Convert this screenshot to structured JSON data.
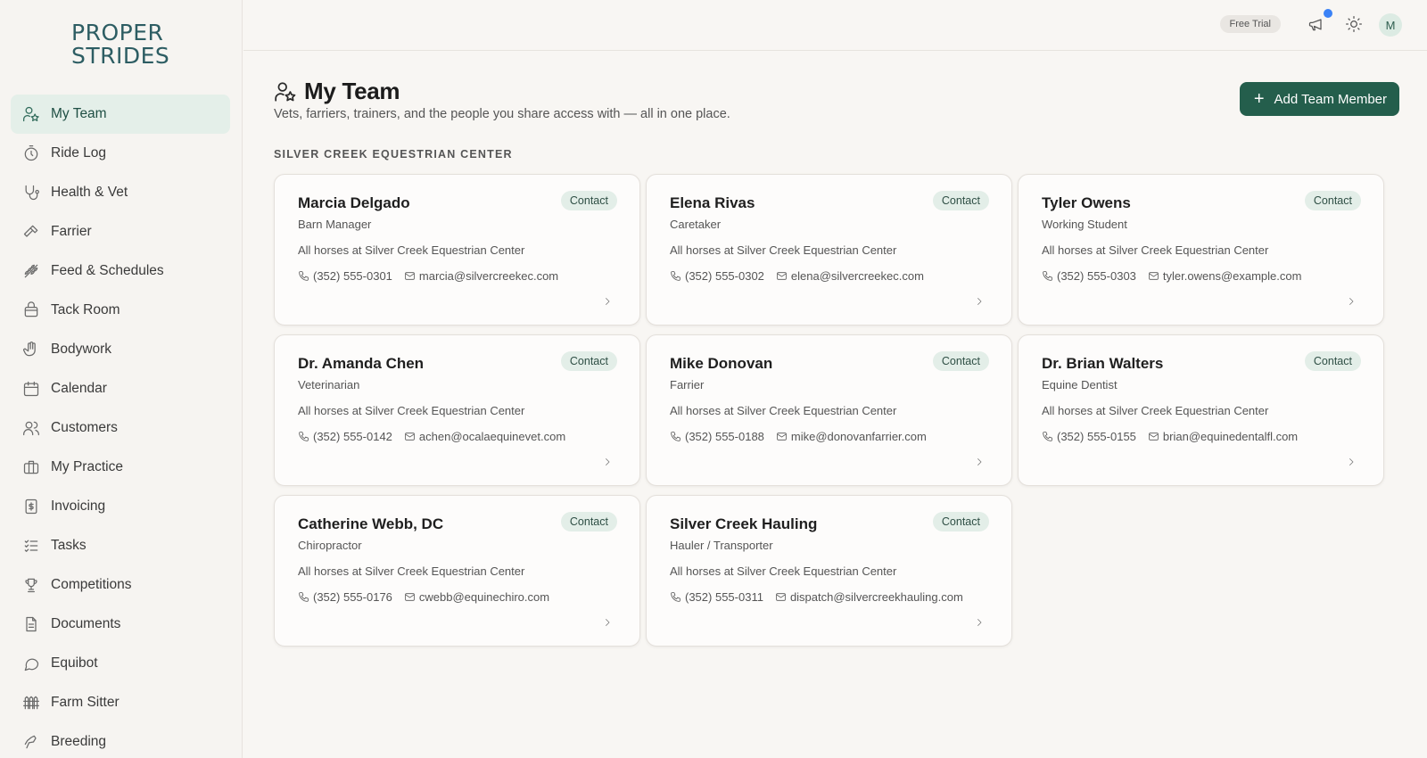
{
  "brand": {
    "line1": "PROPER",
    "line2": "STRIDES",
    "color": "#2d5d63",
    "accent": "#d9a066"
  },
  "topbar": {
    "free_trial": "Free Trial",
    "avatar_initial": "M"
  },
  "sidebar": {
    "items": [
      {
        "label": "My Team",
        "icon": "team-icon",
        "active": true
      },
      {
        "label": "Ride Log",
        "icon": "stopwatch-icon"
      },
      {
        "label": "Health & Vet",
        "icon": "stethoscope-icon"
      },
      {
        "label": "Farrier",
        "icon": "hammer-icon"
      },
      {
        "label": "Feed & Schedules",
        "icon": "wheat-icon"
      },
      {
        "label": "Tack Room",
        "icon": "saddle-icon"
      },
      {
        "label": "Bodywork",
        "icon": "hand-icon"
      },
      {
        "label": "Calendar",
        "icon": "calendar-icon"
      },
      {
        "label": "Customers",
        "icon": "users-icon"
      },
      {
        "label": "My Practice",
        "icon": "briefcase-icon"
      },
      {
        "label": "Invoicing",
        "icon": "invoice-icon"
      },
      {
        "label": "Tasks",
        "icon": "checklist-icon"
      },
      {
        "label": "Competitions",
        "icon": "trophy-icon"
      },
      {
        "label": "Documents",
        "icon": "document-icon"
      },
      {
        "label": "Equibot",
        "icon": "chat-icon"
      },
      {
        "label": "Farm Sitter",
        "icon": "fence-icon"
      },
      {
        "label": "Breeding",
        "icon": "horse-icon"
      }
    ]
  },
  "header": {
    "title": "My Team",
    "subtitle": "Vets, farriers, trainers, and the people you share access with — all in one place.",
    "add_button": "Add Team Member",
    "section": "SILVER CREEK EQUESTRIAN CENTER"
  },
  "members": [
    {
      "name": "Marcia Delgado",
      "role": "Barn Manager",
      "scope": "All horses at Silver Creek Equestrian Center",
      "phone": "(352) 555-0301",
      "email": "marcia@silvercreekec.com",
      "badge": "Contact"
    },
    {
      "name": "Elena Rivas",
      "role": "Caretaker",
      "scope": "All horses at Silver Creek Equestrian Center",
      "phone": "(352) 555-0302",
      "email": "elena@silvercreekec.com",
      "badge": "Contact"
    },
    {
      "name": "Tyler Owens",
      "role": "Working Student",
      "scope": "All horses at Silver Creek Equestrian Center",
      "phone": "(352) 555-0303",
      "email": "tyler.owens@example.com",
      "badge": "Contact"
    },
    {
      "name": "Dr. Amanda Chen",
      "role": "Veterinarian",
      "scope": "All horses at Silver Creek Equestrian Center",
      "phone": "(352) 555-0142",
      "email": "achen@ocalaequinevet.com",
      "badge": "Contact"
    },
    {
      "name": "Mike Donovan",
      "role": "Farrier",
      "scope": "All horses at Silver Creek Equestrian Center",
      "phone": "(352) 555-0188",
      "email": "mike@donovanfarrier.com",
      "badge": "Contact"
    },
    {
      "name": "Dr. Brian Walters",
      "role": "Equine Dentist",
      "scope": "All horses at Silver Creek Equestrian Center",
      "phone": "(352) 555-0155",
      "email": "brian@equinedentalfl.com",
      "badge": "Contact"
    },
    {
      "name": "Catherine Webb, DC",
      "role": "Chiropractor",
      "scope": "All horses at Silver Creek Equestrian Center",
      "phone": "(352) 555-0176",
      "email": "cwebb@equinechiro.com",
      "badge": "Contact"
    },
    {
      "name": "Silver Creek Hauling",
      "role": "Hauler / Transporter",
      "scope": "All horses at Silver Creek Equestrian Center",
      "phone": "(352) 555-0311",
      "email": "dispatch@silvercreekhauling.com",
      "badge": "Contact"
    }
  ]
}
